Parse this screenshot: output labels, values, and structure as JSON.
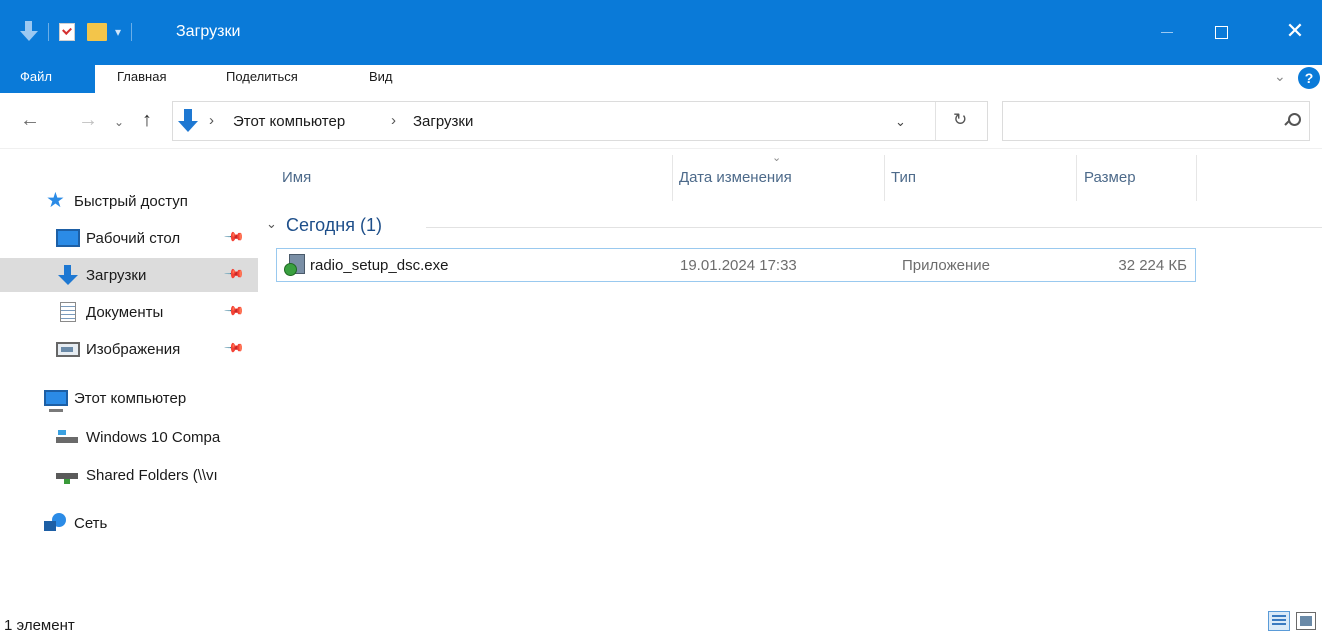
{
  "window": {
    "title": "Загрузки",
    "controls": {
      "minimize": "—",
      "maximize": "☐",
      "close": "✕"
    },
    "accent_color": "#0a7ad8"
  },
  "quick_access_toolbar": {
    "icons": [
      "downloads-arrow-icon",
      "properties-icon",
      "new-folder-icon",
      "customize-dropdown-icon"
    ],
    "dropdown_glyph": "▾"
  },
  "ribbon": {
    "tabs": [
      {
        "label": "Файл",
        "active": true
      },
      {
        "label": "Главная"
      },
      {
        "label": "Поделиться"
      },
      {
        "label": "Вид"
      }
    ],
    "collapse_glyph": "⌄",
    "help_label": "?"
  },
  "navigation": {
    "back_glyph": "←",
    "forward_glyph": "→",
    "recent_glyph": "⌄",
    "up_glyph": "↑",
    "address": {
      "breadcrumb": [
        "Этот компьютер",
        "Загрузки"
      ],
      "separator": "›",
      "dropdown_glyph": "⌄",
      "refresh_glyph": "↻"
    },
    "search": {
      "placeholder": "",
      "value": ""
    }
  },
  "sidebar": {
    "items": [
      {
        "label": "Быстрый доступ",
        "icon": "star-icon"
      },
      {
        "label": "Рабочий стол",
        "icon": "desktop-icon",
        "pinned": true
      },
      {
        "label": "Загрузки",
        "icon": "downloads-icon",
        "pinned": true,
        "selected": true
      },
      {
        "label": "Документы",
        "icon": "documents-icon",
        "pinned": true
      },
      {
        "label": "Изображения",
        "icon": "pictures-icon",
        "pinned": true
      },
      {
        "label": "Этот компьютер",
        "icon": "computer-icon"
      },
      {
        "label": "Windows 10 Compa",
        "icon": "drive-icon"
      },
      {
        "label": "Shared Folders (\\\\vı",
        "icon": "network-drive-icon"
      },
      {
        "label": "Сеть",
        "icon": "network-icon"
      }
    ],
    "pin_glyph": "📌"
  },
  "file_list": {
    "columns": [
      "Имя",
      "Дата изменения",
      "Тип",
      "Размер"
    ],
    "sort_glyph": "⌄",
    "groups": [
      {
        "label": "Сегодня (1)",
        "chevron": "⌄",
        "files": [
          {
            "name": "radio_setup_dsc.exe",
            "date": "19.01.2024 17:33",
            "type": "Приложение",
            "size": "32 224 КБ",
            "icon": "installer-icon"
          }
        ]
      }
    ]
  },
  "status_bar": {
    "item_count": "1 элемент",
    "view_buttons": [
      "details-view-icon",
      "large-icons-view-icon"
    ]
  }
}
